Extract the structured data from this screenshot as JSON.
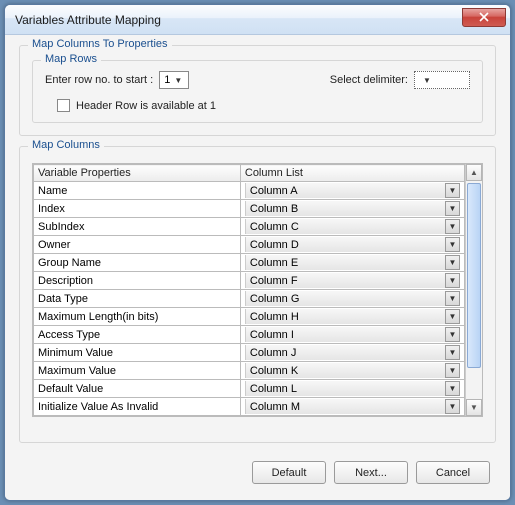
{
  "window": {
    "title": "Variables Attribute Mapping"
  },
  "group_outer": {
    "label": "Map Columns To Properties"
  },
  "group_inner": {
    "label": "Map Rows"
  },
  "row_no_label": "Enter row no. to start :",
  "row_no_value": "1",
  "delimiter_label": "Select delimiter:",
  "delimiter_value": "",
  "header_row_label": "Header Row is available at 1",
  "map_columns_label": "Map Columns",
  "table_headers": {
    "col1": "Variable Properties",
    "col2": "Column List"
  },
  "rows": [
    {
      "prop": "Name",
      "col": "Column A"
    },
    {
      "prop": "Index",
      "col": "Column B"
    },
    {
      "prop": "SubIndex",
      "col": "Column C"
    },
    {
      "prop": "Owner",
      "col": "Column D"
    },
    {
      "prop": "Group Name",
      "col": "Column E"
    },
    {
      "prop": "Description",
      "col": "Column F"
    },
    {
      "prop": "Data Type",
      "col": "Column G"
    },
    {
      "prop": "Maximum Length(in bits)",
      "col": "Column H"
    },
    {
      "prop": "Access Type",
      "col": "Column I"
    },
    {
      "prop": "Minimum Value",
      "col": "Column J"
    },
    {
      "prop": "Maximum Value",
      "col": "Column K"
    },
    {
      "prop": "Default Value",
      "col": "Column L"
    },
    {
      "prop": "Initialize Value As Invalid",
      "col": "Column M"
    }
  ],
  "buttons": {
    "default": "Default",
    "next": "Next...",
    "cancel": "Cancel"
  }
}
